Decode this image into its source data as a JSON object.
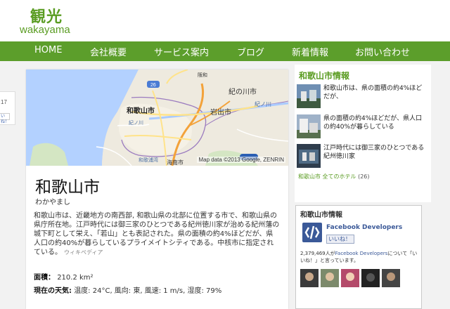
{
  "header": {
    "logo_title": "観光",
    "logo_sub": "wakayama"
  },
  "nav": [
    {
      "label": "HOME"
    },
    {
      "label": "会社概要"
    },
    {
      "label": "サービス案内"
    },
    {
      "label": "ブログ"
    },
    {
      "label": "新着情報"
    },
    {
      "label": "お問い合わせ"
    }
  ],
  "left_stub": {
    "count": "17",
    "button": "いね！"
  },
  "map": {
    "labels": {
      "wakayama_shi": "和歌山市",
      "kinokawa_shi": "紀の川市",
      "iwade_shi": "岩出市",
      "kinokawa_river": "紀ノ川",
      "kinokawa_small": "紀ノ川",
      "wakaura": "和歌浦湾",
      "kainan": "海南市",
      "route": "26",
      "road24": "24",
      "hanwa": "阪和"
    },
    "attribution": "Map data ©2013 Google, ZENRIN"
  },
  "city": {
    "title": "和歌山市",
    "reading": "わかやまし",
    "description": "和歌山市は、近畿地方の南西部, 和歌山県の北部に位置する市で、和歌山県の県庁所在地。江戸時代には御三家のひとつである紀州徳川家が治める紀州藩の城下町として栄え、「若山」とも表記された。県の面積の約4%ほどだが、県人口の約40%が暮らしているプライメイトシティである。中核市に指定されている。",
    "source": "ウィキペディア",
    "area_label": "面積：",
    "area_value": "210.2 km²",
    "weather_label": "現在の天気:",
    "weather_value": "温度: 24°C, 風向: 東, 風速: 1 m/s, 湿度: 79%"
  },
  "sidebar": {
    "title": "和歌山市情報",
    "items": [
      {
        "text": "和歌山市は、県の面積の約4%ほどだが、"
      },
      {
        "text": "県の面積の約4%ほどだが、県人口の約40%が暮らしている"
      },
      {
        "text": "江戸時代には御三家のひとつである紀州徳川家"
      }
    ],
    "link_text": "和歌山市 全てのホテル",
    "link_count": "(26)"
  },
  "fb": {
    "title": "和歌山市情報",
    "page_name": "Facebook Developers",
    "like_button": "いいね！",
    "count_num": "2,379,469人が",
    "count_link": "Facebook Developers",
    "count_rest": "について「いいね！」と言っています。"
  },
  "colors": {
    "brand_green": "#5c9e2b",
    "fb_blue": "#3b5998"
  }
}
